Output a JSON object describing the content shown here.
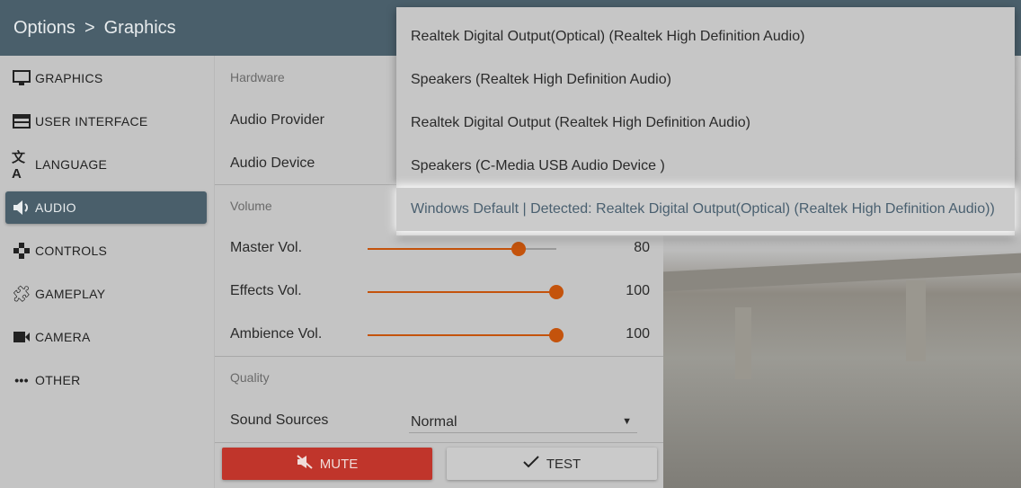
{
  "header": {
    "crumb1": "Options",
    "sep": ">",
    "crumb2": "Graphics"
  },
  "sidebar": {
    "items": [
      {
        "label": "GRAPHICS",
        "icon": "monitor-icon"
      },
      {
        "label": "USER INTERFACE",
        "icon": "window-icon"
      },
      {
        "label": "LANGUAGE",
        "icon": "translate-icon"
      },
      {
        "label": "AUDIO",
        "icon": "speaker-icon",
        "active": true
      },
      {
        "label": "CONTROLS",
        "icon": "gamepad-icon"
      },
      {
        "label": "GAMEPLAY",
        "icon": "puzzle-icon"
      },
      {
        "label": "CAMERA",
        "icon": "video-camera-icon"
      },
      {
        "label": "OTHER",
        "icon": "more-icon"
      }
    ]
  },
  "content": {
    "hardware": "Hardware",
    "audio_provider": "Audio Provider",
    "audio_device": "Audio Device",
    "volume": "Volume",
    "sliders": [
      {
        "label": "Master Vol.",
        "value": "80",
        "fraction": 0.8
      },
      {
        "label": "Effects Vol.",
        "value": "100",
        "fraction": 1.0
      },
      {
        "label": "Ambience Vol.",
        "value": "100",
        "fraction": 1.0
      }
    ],
    "quality": "Quality",
    "sound_sources": "Sound Sources",
    "sound_sources_value": "Normal",
    "mute": "MUTE",
    "test": "TEST"
  },
  "dropdown": {
    "options": [
      "Realtek Digital Output(Optical) (Realtek High Definition Audio)",
      "Speakers (Realtek High Definition Audio)",
      "Realtek Digital Output (Realtek High Definition Audio)",
      "Speakers (C-Media USB Audio Device )",
      "Windows Default | Detected: Realtek Digital Output(Optical) (Realtek High Definition Audio))"
    ]
  },
  "colors": {
    "header": "#4a5f6b",
    "accent": "#c4530c",
    "mute": "#c0352b"
  }
}
